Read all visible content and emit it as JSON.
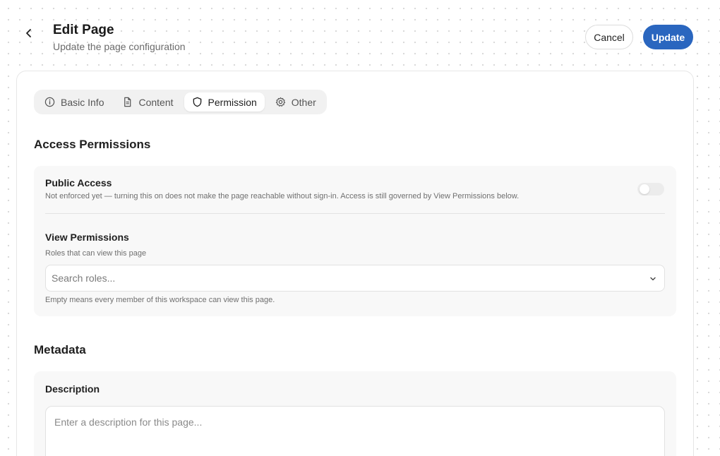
{
  "header": {
    "title": "Edit Page",
    "subtitle": "Update the page configuration",
    "cancel_label": "Cancel",
    "update_label": "Update"
  },
  "tabs": [
    {
      "label": "Basic Info",
      "icon": "info-icon",
      "active": false
    },
    {
      "label": "Content",
      "icon": "document-icon",
      "active": false
    },
    {
      "label": "Permission",
      "icon": "shield-icon",
      "active": true
    },
    {
      "label": "Other",
      "icon": "gear-icon",
      "active": false
    }
  ],
  "access": {
    "title": "Access Permissions",
    "public_access": {
      "label": "Public Access",
      "help": "Not enforced yet — turning this on does not make the page reachable without sign-in. Access is still governed by View Permissions below.",
      "enabled": false
    },
    "view_permissions": {
      "label": "View Permissions",
      "help": "Roles that can view this page",
      "value": "",
      "placeholder": "Search roles...",
      "footnote": "Empty means every member of this workspace can view this page."
    }
  },
  "metadata": {
    "title": "Metadata",
    "description": {
      "label": "Description",
      "value": "",
      "placeholder": "Enter a description for this page..."
    }
  },
  "colors": {
    "primary": "#2a66bf",
    "background": "#ffffff",
    "panel": "#f8f8f8"
  }
}
